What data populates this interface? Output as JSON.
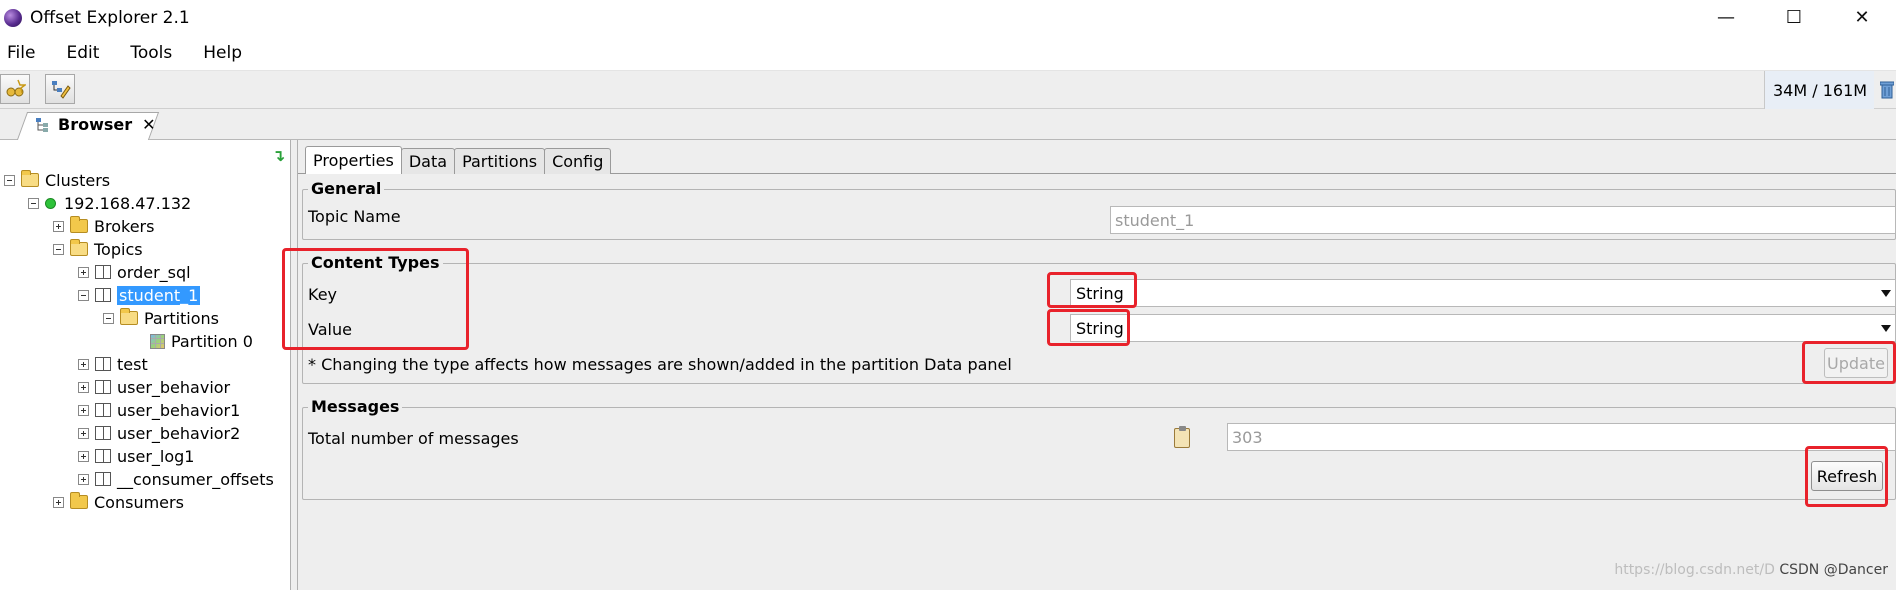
{
  "window": {
    "title": "Offset Explorer  2.1",
    "minimize": "—",
    "maximize": "☐",
    "close": "✕"
  },
  "menu": {
    "items": [
      "File",
      "Edit",
      "Tools",
      "Help"
    ]
  },
  "toolbar": {
    "memory": "34M / 161M"
  },
  "browser_tab": {
    "label": "Browser",
    "close": "✕"
  },
  "tree": {
    "clusters": "Clusters",
    "host": "192.168.47.132",
    "brokers": "Brokers",
    "topics": "Topics",
    "topic_order_sql": "order_sql",
    "topic_student_1": "student_1",
    "partitions": "Partitions",
    "partition_0": "Partition 0",
    "topic_test": "test",
    "topic_user_behavior": "user_behavior",
    "topic_user_behavior1": "user_behavior1",
    "topic_user_behavior2": "user_behavior2",
    "topic_user_log1": "user_log1",
    "topic_consumer_offsets": "__consumer_offsets",
    "consumers": "Consumers"
  },
  "tabs": {
    "properties": "Properties",
    "data": "Data",
    "partitions": "Partitions",
    "config": "Config"
  },
  "general": {
    "title": "General",
    "topic_name_label": "Topic Name",
    "topic_name_value": "student_1"
  },
  "content_types": {
    "title": "Content Types",
    "key_label": "Key",
    "key_value": "String",
    "value_label": "Value",
    "value_value": "String",
    "note": "* Changing the type affects how messages are shown/added in the partition Data panel",
    "update_button": "Update"
  },
  "messages": {
    "title": "Messages",
    "total_label": "Total number of messages",
    "total_value": "303",
    "refresh_button": "Refresh"
  },
  "watermark": {
    "text": "https://blog.csdn.net/D",
    "brand": "CSDN @Dancer"
  },
  "colors": {
    "highlight_red": "#e8222b",
    "selection_blue": "#3399ff",
    "panel_gray": "#eeeeee"
  }
}
